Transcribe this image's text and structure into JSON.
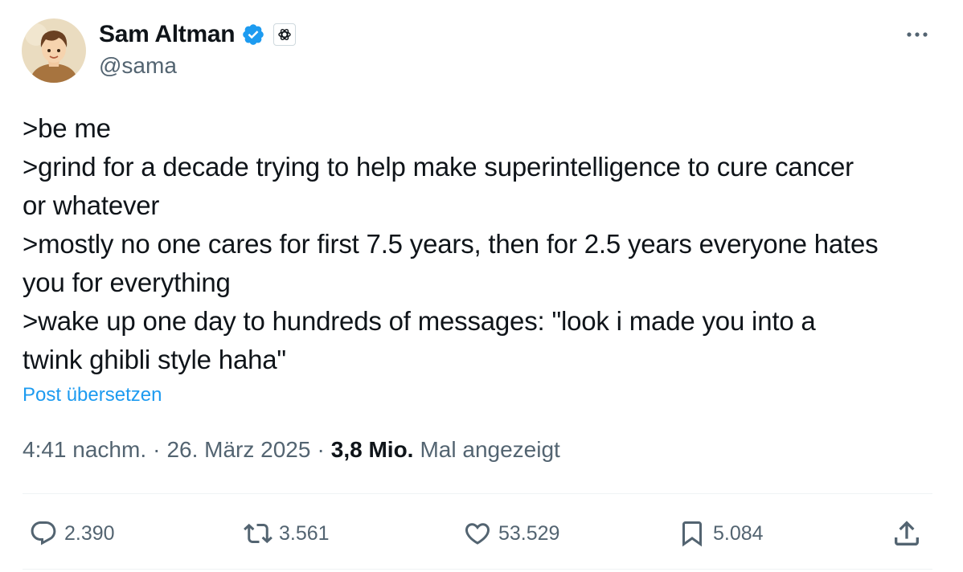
{
  "author": {
    "display_name": "Sam Altman",
    "handle": "@sama"
  },
  "tweet": {
    "lines": [
      ">be me",
      ">grind for a decade trying to help make superintelligence to cure cancer",
      "or whatever",
      ">mostly no one cares for first 7.5 years, then for 2.5 years everyone hates",
      "you for everything",
      ">wake up one day to hundreds of messages: \"look i made you into a",
      "twink ghibli style haha\""
    ],
    "translate_label": "Post übersetzen"
  },
  "meta": {
    "time": "4:41 nachm.",
    "separator": "·",
    "date": "26. März 2025",
    "views_count": "3,8 Mio.",
    "views_label": "Mal angezeigt"
  },
  "actions": {
    "replies": "2.390",
    "reposts": "3.561",
    "likes": "53.529",
    "bookmarks": "5.084"
  },
  "colors": {
    "text": "#0f1419",
    "secondary": "#536471",
    "link": "#1d9bf0",
    "verified": "#1d9bf0",
    "divider": "#eff3f4"
  },
  "icons": [
    "verified-badge-icon",
    "openai-affiliate-icon",
    "more-icon",
    "reply-icon",
    "repost-icon",
    "like-icon",
    "bookmark-icon",
    "share-icon"
  ]
}
